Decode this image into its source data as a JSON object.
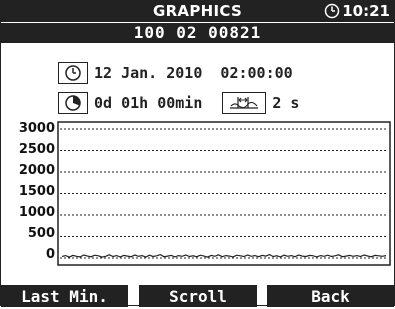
{
  "header": {
    "title": "GRAPHICS",
    "time": "10:21",
    "device_id": "100 02 00821"
  },
  "info": {
    "start_datetime": "12 Jan. 2010  02:00:00",
    "duration": "0d 01h 00min",
    "interval": "2 s"
  },
  "chart_data": {
    "type": "line",
    "title": "",
    "xlabel": "",
    "ylabel": "",
    "ylim": [
      0,
      3000
    ],
    "yticks": [
      "3000",
      "2500",
      "2000",
      "1500",
      "1000",
      "500",
      "0"
    ],
    "grid": true,
    "series": [
      {
        "values": [
          35,
          55,
          20,
          60,
          40,
          25,
          70,
          45,
          30,
          65,
          50,
          20,
          40,
          75,
          35,
          55,
          25,
          60,
          45,
          30,
          70,
          40,
          55,
          20,
          65,
          35,
          50,
          80,
          30,
          45,
          60,
          25,
          55,
          40,
          70,
          35,
          50,
          30,
          65,
          45,
          20,
          60,
          40,
          75,
          30,
          55,
          45,
          25,
          65,
          50,
          35,
          70,
          40,
          55,
          30,
          60,
          45,
          80,
          35,
          50,
          25,
          65,
          40,
          55,
          30,
          70,
          45,
          35,
          60,
          50,
          25,
          55,
          40,
          65,
          35,
          50,
          75,
          30,
          45,
          60,
          40,
          55,
          35,
          70,
          45,
          30,
          60,
          50,
          40,
          55
        ]
      }
    ]
  },
  "softkeys": {
    "left": "Last Min.",
    "middle": "Scroll",
    "right": "Back"
  },
  "colors": {
    "background": "#ffffff",
    "ink": "#222222"
  },
  "icons": [
    "clock-icon",
    "calendar-clock-icon",
    "duration-icon",
    "interval-icon"
  ]
}
